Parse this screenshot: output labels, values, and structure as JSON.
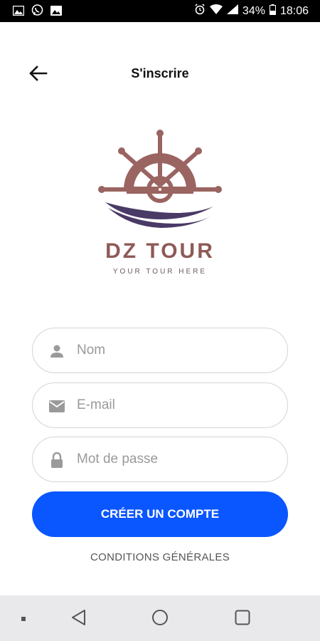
{
  "status_bar": {
    "battery": "34%",
    "time": "18:06"
  },
  "header": {
    "title": "S'inscrire"
  },
  "brand": {
    "name": "DZ TOUR",
    "tagline": "YOUR TOUR HERE"
  },
  "form": {
    "name_placeholder": "Nom",
    "email_placeholder": "E-mail",
    "password_placeholder": "Mot de passe",
    "submit_label": "CRÉER UN COMPTE",
    "terms_label": "CONDITIONS GÉNÉRALES"
  },
  "colors": {
    "accent": "#0a56ff",
    "brand": "#8e5a57",
    "wave": "#4a3a66"
  }
}
